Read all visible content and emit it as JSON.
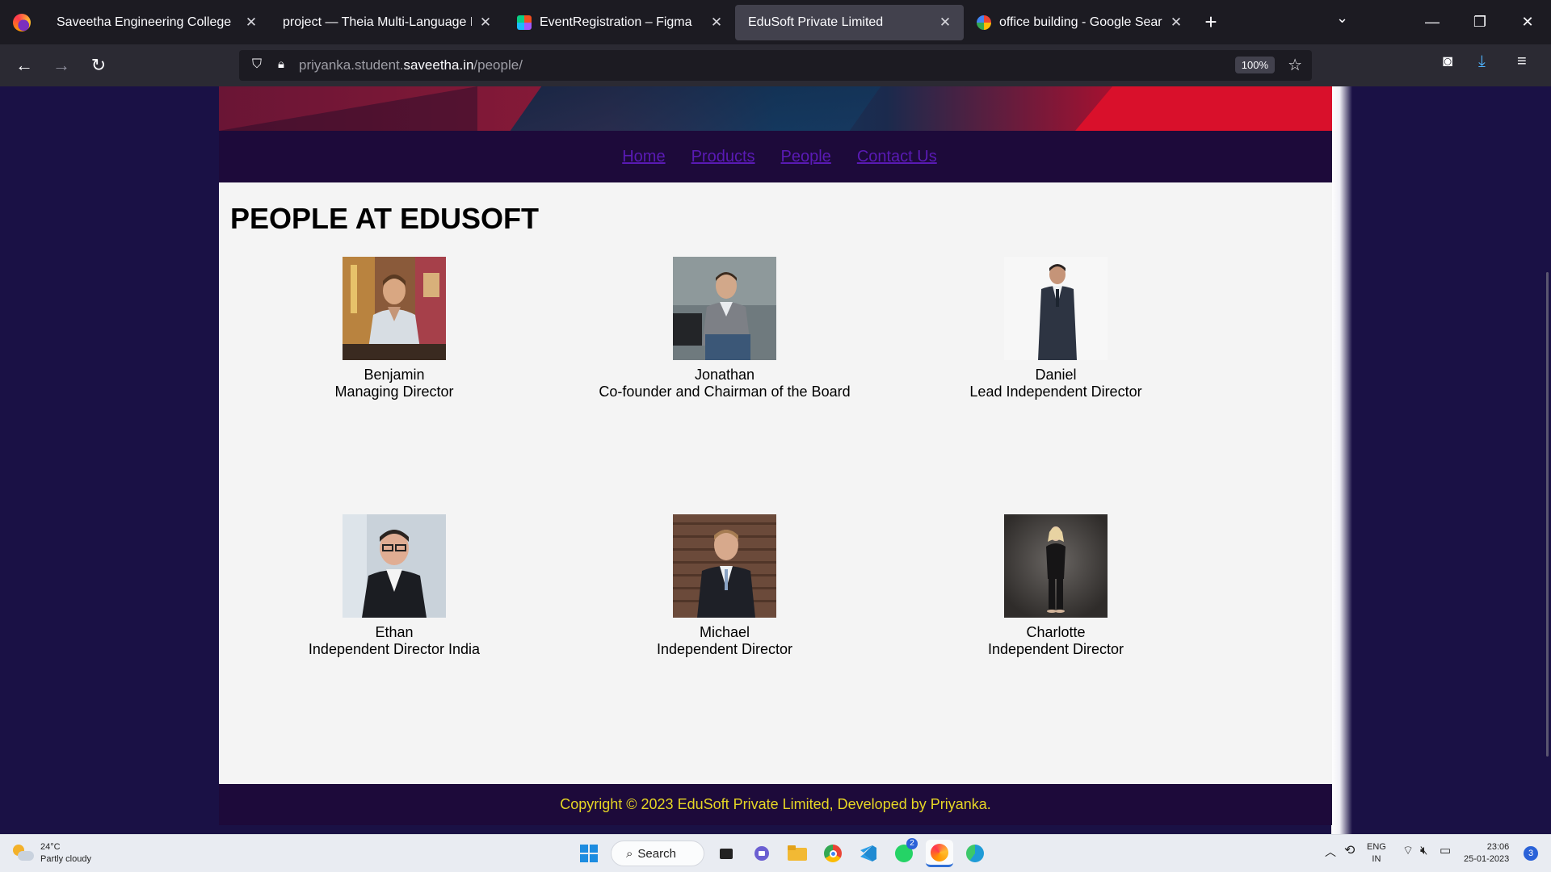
{
  "browser": {
    "tabs": [
      {
        "label": "Saveetha Engineering College",
        "active": false
      },
      {
        "label": "project — Theia Multi-Language Exa",
        "active": false
      },
      {
        "label": "EventRegistration – Figma",
        "active": false
      },
      {
        "label": "EduSoft Private Limited",
        "active": true
      },
      {
        "label": "office building - Google Search",
        "active": false
      }
    ],
    "new_tab": "+",
    "url_prefix": "priyanka.student.",
    "url_host": "saveetha.in",
    "url_path": "/people/",
    "zoom": "100%"
  },
  "site": {
    "nav": [
      "Home",
      "Products",
      "People",
      "Contact Us"
    ],
    "title": "PEOPLE AT EDUSOFT",
    "people": [
      {
        "name": "Benjamin",
        "role": "Managing Director"
      },
      {
        "name": "Jonathan",
        "role": "Co-founder and Chairman of the Board"
      },
      {
        "name": "Daniel",
        "role": "Lead Independent Director"
      },
      {
        "name": "Ethan",
        "role": "Independent Director India"
      },
      {
        "name": "Michael",
        "role": "Independent Director"
      },
      {
        "name": "Charlotte",
        "role": "Independent Director"
      }
    ],
    "footer": "Copyright © 2023 EduSoft Private Limited, Developed by Priyanka.",
    "colors": {
      "nav_link": "#5a1ab5",
      "footer_text": "#e6d624",
      "nav_bg": "#1d0a3a"
    }
  },
  "taskbar": {
    "temp": "24°C",
    "weather": "Partly cloudy",
    "search": "Search",
    "whatsapp_badge": "2",
    "lang": "ENG",
    "region": "IN",
    "time": "23:06",
    "date": "25-01-2023",
    "notifications": "3"
  }
}
